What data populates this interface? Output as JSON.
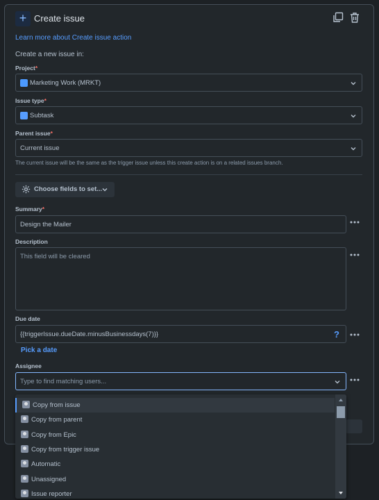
{
  "header": {
    "title": "Create issue",
    "plus_symbol": "+",
    "icons": [
      "duplicate-icon",
      "trash-icon"
    ]
  },
  "learn_more_link": "Learn more about Create issue action",
  "intro_text": "Create a new issue in:",
  "project": {
    "label": "Project",
    "value": "Marketing Work (MRKT)"
  },
  "issue_type": {
    "label": "Issue type",
    "value": "Subtask"
  },
  "parent_issue": {
    "label": "Parent issue",
    "value": "Current issue",
    "help": "The current issue will be the same as the trigger issue unless this create action is on a related issues branch."
  },
  "choose_fields_button": "Choose fields to set...",
  "summary": {
    "label": "Summary",
    "value": "Design the Mailer"
  },
  "description": {
    "label": "Description",
    "value": "This field will be cleared"
  },
  "due_date": {
    "label": "Due date",
    "value": "{{triggerIssue.dueDate.minusBusinessdays(7)}}",
    "help_icon": "?",
    "pick_link": "Pick a date"
  },
  "assignee": {
    "label": "Assignee",
    "placeholder": "Type to find matching users...",
    "options": [
      "Copy from issue",
      "Copy from parent",
      "Copy from Epic",
      "Copy from trigger issue",
      "Automatic",
      "Unassigned",
      "Issue reporter"
    ]
  },
  "required_marker": "*",
  "colors": {
    "background": "#1d2125",
    "panel": "#22272b",
    "link": "#579dff",
    "required": "#f87168",
    "focus_border": "#85b8ff"
  }
}
